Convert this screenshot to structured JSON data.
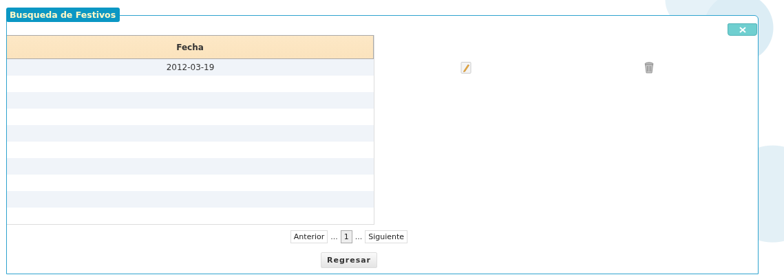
{
  "panel": {
    "title": "Busqueda de Festivos"
  },
  "table": {
    "columns": [
      "Fecha"
    ],
    "rows": [
      {
        "cells": [
          "2012-03-19"
        ],
        "actions": [
          {
            "kind": "edit"
          },
          {
            "kind": "delete"
          }
        ]
      }
    ]
  },
  "pager": {
    "previous": "Anterior",
    "ellipsis_before": "...",
    "pages": [
      {
        "label": "1",
        "selected": true
      }
    ],
    "ellipsis_after": "...",
    "next": "Siguiente"
  },
  "buttons": [
    "Regresar"
  ]
}
